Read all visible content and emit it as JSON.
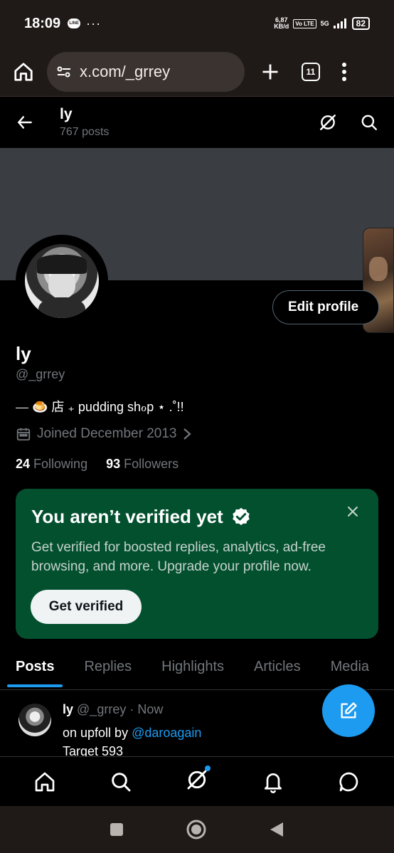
{
  "status_bar": {
    "time": "18:09",
    "app_badge": "LINE",
    "more": "···",
    "speed_value": "6,87",
    "speed_unit": "KB/d",
    "volte": "Vo LTE",
    "network": "5G",
    "battery": "82"
  },
  "browser": {
    "url": "x.com/_grrey",
    "tab_count": "11"
  },
  "header": {
    "name": "ly",
    "post_count": "767 posts"
  },
  "profile": {
    "edit_label": "Edit profile",
    "name": "ly",
    "handle": "@_grrey",
    "bio": "⎯⎯ 🍮 店 ₊ pudding shℴp ⋆ .˚!!",
    "joined": "Joined December 2013",
    "following_count": "24",
    "following_label": "Following",
    "followers_count": "93",
    "followers_label": "Followers"
  },
  "verify_card": {
    "title": "You aren’t verified yet",
    "description": "Get verified for boosted replies, analytics, ad-free browsing, and more. Upgrade your profile now.",
    "button": "Get verified",
    "bg_color": "#03502f"
  },
  "tabs": [
    {
      "label": "Posts",
      "active": true
    },
    {
      "label": "Replies",
      "active": false
    },
    {
      "label": "Highlights",
      "active": false
    },
    {
      "label": "Articles",
      "active": false
    },
    {
      "label": "Media",
      "active": false
    }
  ],
  "post": {
    "name": "ly",
    "meta": "@_grrey · Now",
    "text_prefix": "on upfoll by ",
    "mention": "@daroagain",
    "line2": "Target 593"
  },
  "bottom_nav": [
    "home-icon",
    "search-icon",
    "grok-icon",
    "bell-icon",
    "messages-icon"
  ],
  "colors": {
    "accent": "#1d9bf0",
    "muted": "#71767b",
    "chrome": "#1f1a18"
  }
}
